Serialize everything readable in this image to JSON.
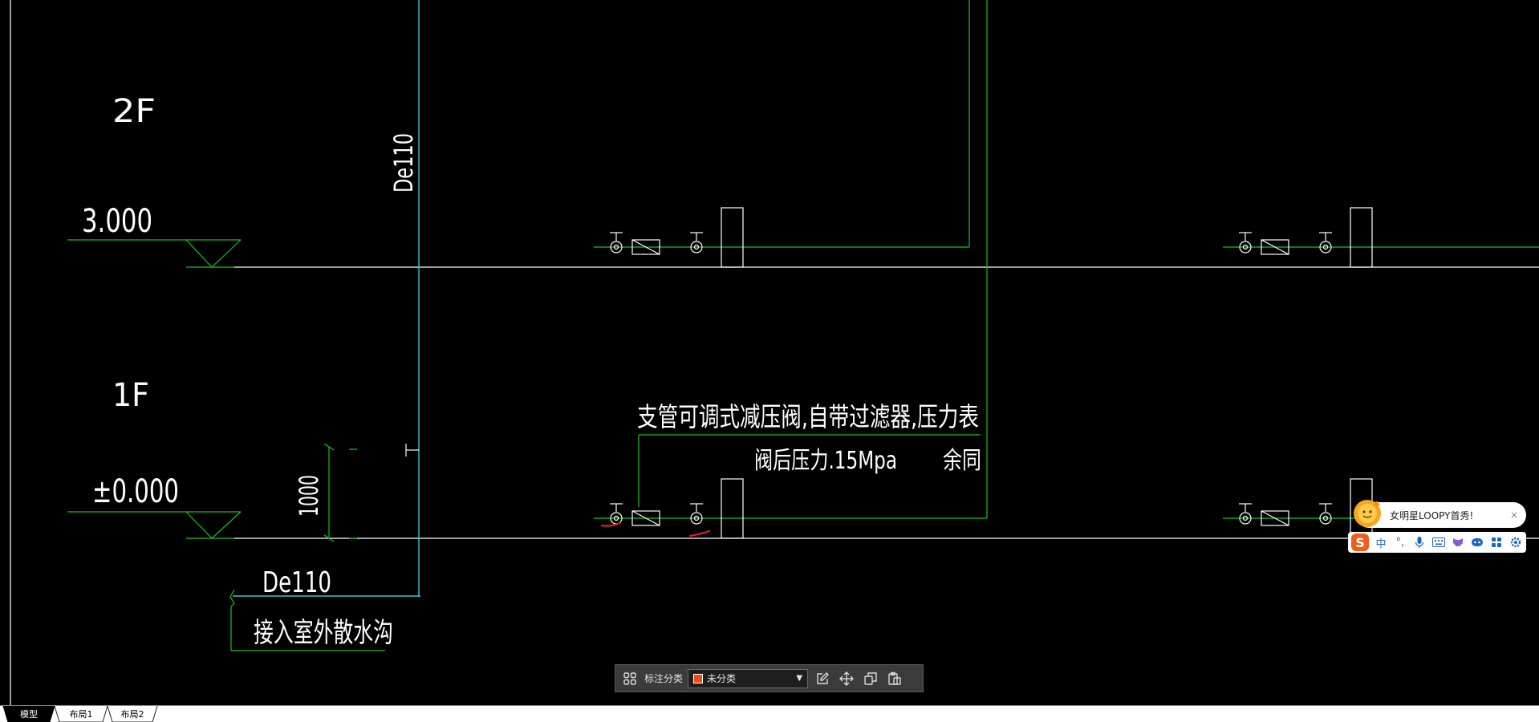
{
  "drawing": {
    "floor_2": "2F",
    "floor_1": "1F",
    "elev_2": "3.000",
    "elev_1": "±0.000",
    "pipe_vertical": "De110",
    "pipe_horizontal": "De110",
    "outlet_note": "接入室外散水沟",
    "dimension": "1000",
    "note_line1": "支管可调式减压阀,自带过滤器,压力表",
    "note_line2": "阀后压力.15Mpa",
    "note_line3": "余同"
  },
  "annotation_toolbar": {
    "label": "标注分类",
    "selected_category": "未分类",
    "swatch_color": "#e8501a",
    "icons": [
      "grid-icon",
      "edit-icon",
      "move-icon",
      "copy-icon",
      "paste-icon"
    ]
  },
  "ime": {
    "popup_message": "女明星LOOPY首秀!",
    "close_glyph": "×",
    "logo_glyph": "S",
    "lang_label": "中",
    "punct_glyph": "°,",
    "icons": [
      "microphone-icon",
      "keyboard-icon",
      "skin-icon",
      "emoji-icon",
      "toolbox-icon",
      "settings-icon"
    ]
  },
  "tabs": [
    "模型",
    "布局1",
    "布局2"
  ],
  "colors": {
    "background": "#000000",
    "white_line": "#ffffff",
    "green_line": "#19c219",
    "cyan_line": "#35c8d4",
    "red_mark": "#e02020"
  }
}
